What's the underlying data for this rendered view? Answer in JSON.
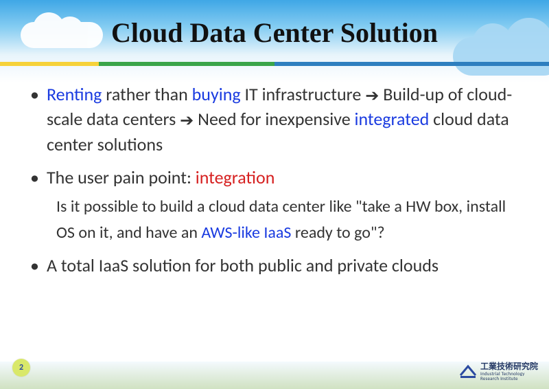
{
  "title": "Cloud Data Center Solution",
  "page_number": "2",
  "arrow_glyph": "➔",
  "bullets": {
    "b1": {
      "t1": "Renting",
      "t2": " rather than ",
      "t3": "buying",
      "t4": " IT infrastructure ",
      "t5": " Build-up of cloud-scale data centers ",
      "t6": " Need for inexpensive ",
      "t7": "integrated",
      "t8": " cloud data center solutions"
    },
    "b2": {
      "t1": "The user pain point: ",
      "t2": "integration",
      "sub1": "Is it possible to build a cloud data center like \"take a HW box, install OS on it, and have an ",
      "sub2": "AWS-like IaaS",
      "sub3": " ready to go\"?"
    },
    "b3": {
      "t1": "A total IaaS solution for both public and private clouds"
    }
  },
  "org": {
    "zh": "工業技術研究院",
    "en1": "Industrial Technology",
    "en2": "Research Institute"
  },
  "colors": {
    "highlight_blue": "#1a3be0",
    "highlight_red": "#d62020",
    "underline_yellow": "#f6d23a",
    "underline_green": "#3aa54a",
    "underline_blue": "#2e7fbf"
  }
}
